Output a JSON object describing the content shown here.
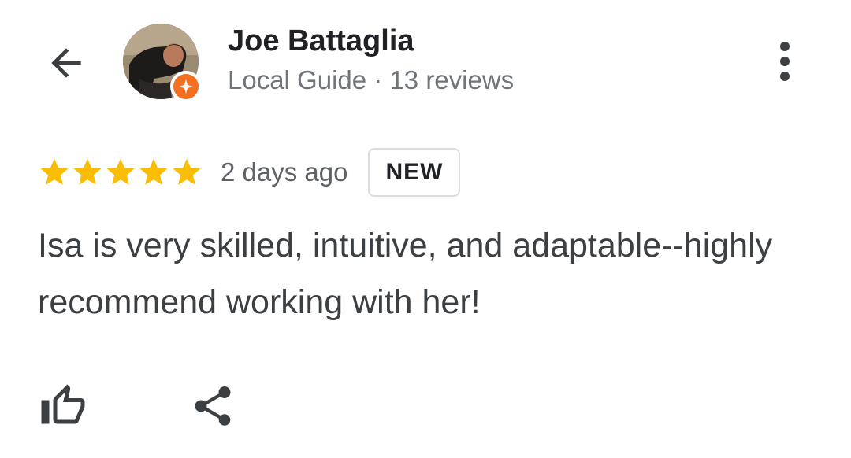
{
  "header": {
    "back_icon": "arrow-left-icon",
    "menu_icon": "more-vertical-icon"
  },
  "author": {
    "name": "Joe Battaglia",
    "meta": "Local Guide · 13 reviews",
    "badge_icon": "local-guide-star-icon",
    "badge_color": "#f37021"
  },
  "review": {
    "rating": 5,
    "rating_max": 5,
    "star_color": "#fbbc04",
    "time_ago": "2 days ago",
    "badge_label": "NEW",
    "text": "Isa is very skilled, intuitive, and adaptable--highly recommend working with her!"
  },
  "actions": {
    "like_icon": "thumb-up-icon",
    "share_icon": "share-icon"
  },
  "colors": {
    "text_primary": "#202124",
    "text_secondary": "#70757a",
    "icon": "#3c4043"
  }
}
